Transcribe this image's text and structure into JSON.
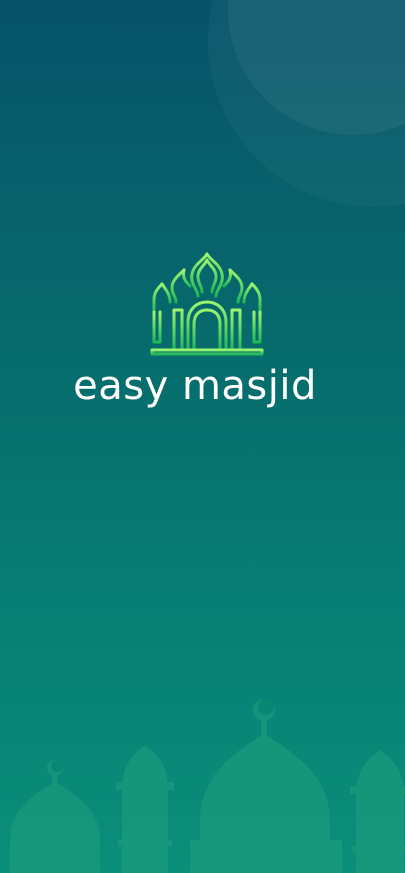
{
  "app": {
    "name": "easy masjid"
  },
  "theme": {
    "gradient_top": "#07536a",
    "gradient_bottom": "#0a8f79",
    "logo_light": "#8cf06a",
    "logo_dark": "#1fbf5a",
    "text_color": "#ffffff"
  },
  "icons": {
    "logo": "mosque-arch-logo-icon",
    "background": "mosque-skyline-icon"
  }
}
